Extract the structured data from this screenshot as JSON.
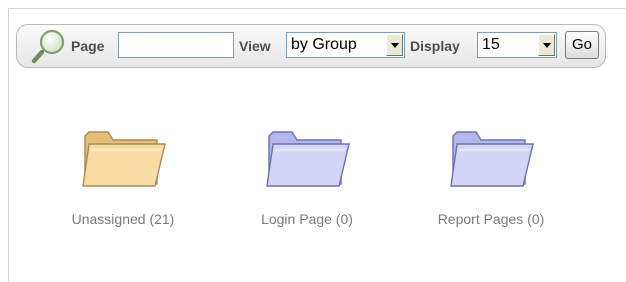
{
  "toolbar": {
    "search_icon": "magnifier-icon",
    "page_label": "Page",
    "page_value": "",
    "view_label": "View",
    "view_value": "by Group",
    "display_label": "Display",
    "display_value": "15",
    "go_label": "Go"
  },
  "groups": [
    {
      "label": "Unassigned (21)",
      "icon": "folder-icon",
      "color": "#f5d79a"
    },
    {
      "label": "Login Page (0)",
      "icon": "folder-icon",
      "color": "#c6c9f3"
    },
    {
      "label": "Report Pages (0)",
      "icon": "folder-icon",
      "color": "#c6c9f3"
    }
  ]
}
